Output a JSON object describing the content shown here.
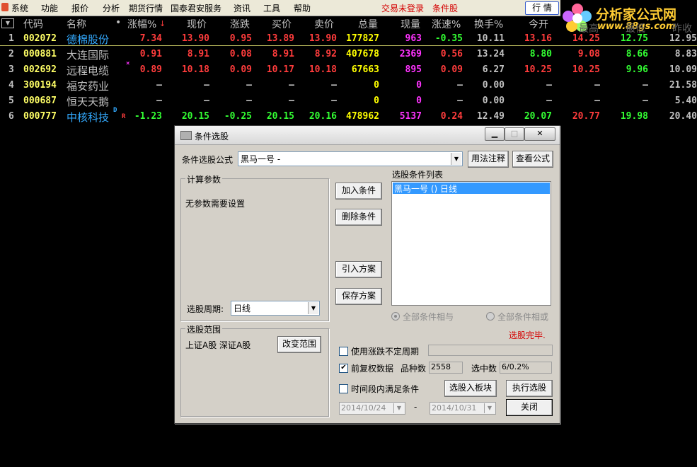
{
  "menu": {
    "items": [
      "系统",
      "功能",
      "报价",
      "分析",
      "期货行情",
      "国泰君安服务",
      "资讯",
      "工具",
      "帮助"
    ],
    "trade_status": "交易未登录",
    "condition_pick": "条件股",
    "quote_button": "行 情"
  },
  "logo": {
    "text": "分析家公式网",
    "url": "www.88gs.com"
  },
  "table": {
    "columns": [
      "代码",
      "名称",
      "涨幅%",
      "现价",
      "涨跌",
      "买价",
      "卖价",
      "总量",
      "现量",
      "涨速%",
      "换手%",
      "今开",
      "最高",
      "最低",
      "昨收"
    ],
    "rows": [
      {
        "no": "1",
        "code": "002072",
        "name": "德棉股份",
        "mark": "",
        "chg_pct": "7.34",
        "price": "13.90",
        "chg": "0.95",
        "bid": "13.89",
        "ask": "13.90",
        "vol": "177827",
        "cur_vol": "963",
        "speed": "-0.35",
        "turnover": "10.11",
        "open": "13.16",
        "high": "14.25",
        "low": "12.75",
        "prev": "12.95"
      },
      {
        "no": "2",
        "code": "000881",
        "name": "大连国际",
        "mark": "",
        "chg_pct": "0.91",
        "price": "8.91",
        "chg": "0.08",
        "bid": "8.91",
        "ask": "8.92",
        "vol": "407678",
        "cur_vol": "2369",
        "speed": "0.56",
        "turnover": "13.24",
        "open": "8.80",
        "high": "9.08",
        "low": "8.66",
        "prev": "8.83"
      },
      {
        "no": "3",
        "code": "002692",
        "name": "远程电缆",
        "mark": "×",
        "chg_pct": "0.89",
        "price": "10.18",
        "chg": "0.09",
        "bid": "10.17",
        "ask": "10.18",
        "vol": "67663",
        "cur_vol": "895",
        "speed": "0.09",
        "turnover": "6.27",
        "open": "10.25",
        "high": "10.25",
        "low": "9.96",
        "prev": "10.09"
      },
      {
        "no": "4",
        "code": "300194",
        "name": "福安药业",
        "mark": "",
        "chg_pct": "–",
        "price": "–",
        "chg": "–",
        "bid": "–",
        "ask": "–",
        "vol": "0",
        "cur_vol": "0",
        "speed": "–",
        "turnover": "0.00",
        "open": "–",
        "high": "–",
        "low": "–",
        "prev": "21.58"
      },
      {
        "no": "5",
        "code": "000687",
        "name": "恒天天鹅",
        "mark": "",
        "chg_pct": "–",
        "price": "–",
        "chg": "–",
        "bid": "–",
        "ask": "–",
        "vol": "0",
        "cur_vol": "0",
        "speed": "–",
        "turnover": "0.00",
        "open": "–",
        "high": "–",
        "low": "–",
        "prev": "5.40"
      },
      {
        "no": "6",
        "code": "000777",
        "name": "中核科技",
        "mark": "DR",
        "chg_pct": "-1.23",
        "price": "20.15",
        "chg": "-0.25",
        "bid": "20.15",
        "ask": "20.16",
        "vol": "478962",
        "cur_vol": "5137",
        "speed": "0.24",
        "turnover": "12.49",
        "open": "20.07",
        "high": "20.77",
        "low": "19.98",
        "prev": "20.40"
      }
    ]
  },
  "dialog": {
    "title": "条件选股",
    "formula_label": "条件选股公式",
    "formula_value": "黑马一号 -",
    "usage_button": "用法注释",
    "view_formula_button": "查看公式",
    "calc_params_label": "计算参数",
    "no_params_text": "无参数需要设置",
    "add_condition": "加入条件",
    "delete_condition": "删除条件",
    "import_scheme": "引入方案",
    "save_scheme": "保存方案",
    "condition_list_label": "选股条件列表",
    "condition_item": "黑马一号 () 日线",
    "all_and": "全部条件相与",
    "all_or": "全部条件相或",
    "period_label": "选股周期:",
    "period_value": "日线",
    "done_text": "选股完毕.",
    "range_label": "选股范围",
    "range_value": "上证A股 深证A股",
    "change_range": "改变范围",
    "use_unfixed_period": "使用涨跌不定周期",
    "pre_adjust": "前复权数据",
    "varieties_label": "品种数",
    "varieties_value": "2558",
    "selected_label": "选中数",
    "selected_value": "6/0.2%",
    "time_range_label": "时间段内满足条件",
    "to_block_button": "选股入板块",
    "run_button": "执行选股",
    "date_from": "2014/10/24",
    "date_sep": "-",
    "date_to": "2014/10/31",
    "close_button": "关闭"
  },
  "colors": {
    "up": "#ff3c3c",
    "down": "#33ff33",
    "volume": "#ffff00",
    "cur_vol": "#ff33ff",
    "code": "#ffff66",
    "name": "#c0c0c0",
    "neutral": "#c0c0c0"
  }
}
